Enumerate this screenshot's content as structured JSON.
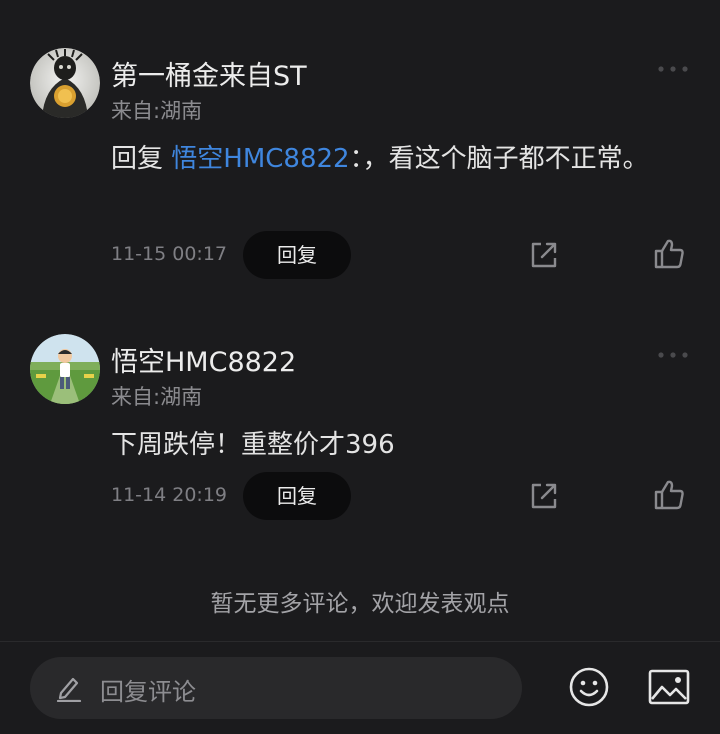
{
  "comments": [
    {
      "username": "第一桶金来自ST",
      "location": "来自:湖南",
      "reply_prefix": "回复 ",
      "mention": "悟空HMC8822",
      "text": "：，看这个脑子都不正常。",
      "timestamp": "11-15 00:17",
      "reply_label": "回复",
      "avatar_icon": "dark-figure-avatar"
    },
    {
      "username": "悟空HMC8822",
      "location": "来自:湖南",
      "text": "下周跌停！重整价才396",
      "timestamp": "11-14 20:19",
      "reply_label": "回复",
      "avatar_icon": "cartoon-boy-avatar"
    }
  ],
  "no_more_text": "暂无更多评论，欢迎发表观点",
  "footer": {
    "input_placeholder": "回复评论"
  },
  "icons": {
    "more": "more-icon",
    "share": "share-icon",
    "like": "thumbs-up-icon",
    "pen": "pen-icon",
    "emoji": "emoji-icon",
    "image": "image-icon"
  },
  "colors": {
    "background": "#1b1b1d",
    "mention": "#3f86de",
    "reply_button": "#0c0c0d",
    "input_bg": "#29292b"
  }
}
